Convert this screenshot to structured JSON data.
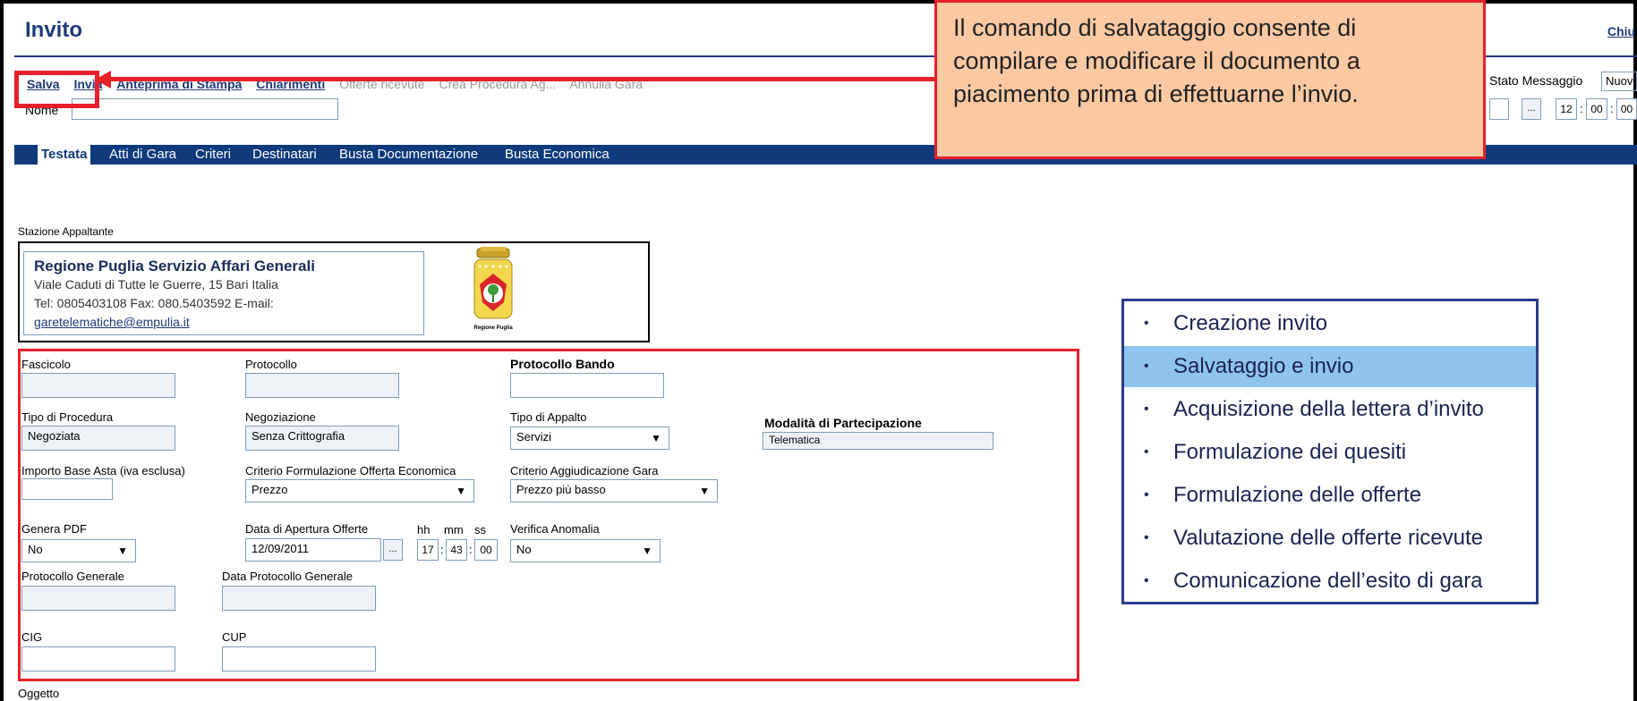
{
  "window": {
    "title": "Invito",
    "close_label": "Chiu"
  },
  "toolbar": {
    "salva": "Salva",
    "invia": "Invia",
    "anteprima": "Anteprima di Stampa",
    "chiarimenti": "Chiarimenti",
    "offerte": "Offerte ricevute",
    "crea_procedura": "Crea Procedura Ag...",
    "annulla": "Annulla Gara"
  },
  "header": {
    "name_label": "Nome",
    "name_value": "",
    "stato_label": "Stato Messaggio",
    "stato_value": "Nuov",
    "date_btn": "...",
    "time": {
      "hh": "12",
      "mm": "00",
      "ss": "00",
      "sep": ":"
    }
  },
  "tabs": [
    "Testata",
    "Atti di Gara",
    "Criteri",
    "Destinatari",
    "Busta Documentazione",
    "Busta Economica"
  ],
  "stazione": {
    "section_label": "Stazione Appaltante",
    "name": "Regione Puglia Servizio Affari Generali",
    "address": "Viale Caduti di Tutte le Guerre, 15 Bari Italia",
    "contacts": "Tel: 0805403108 Fax: 080.5403592 E-mail:",
    "email": "garetelematiche@empulia.it",
    "logo_caption": "Regione Puglia"
  },
  "form": {
    "fascicolo": {
      "label": "Fascicolo",
      "value": ""
    },
    "protocollo": {
      "label": "Protocollo",
      "value": ""
    },
    "protocollo_bando": {
      "label": "Protocollo Bando",
      "value": ""
    },
    "tipo_procedura": {
      "label": "Tipo di Procedura",
      "value": "Negoziata"
    },
    "negoziazione": {
      "label": "Negoziazione",
      "value": "Senza Crittografia"
    },
    "tipo_appalto": {
      "label": "Tipo di Appalto",
      "value": "Servizi"
    },
    "modalita": {
      "label": "Modalità di Partecipazione",
      "value": "Telematica"
    },
    "importo": {
      "label": "Importo Base Asta (iva esclusa)",
      "value": ""
    },
    "criterio_formulazione": {
      "label": "Criterio Formulazione Offerta Economica",
      "value": "Prezzo"
    },
    "criterio_aggiudicazione": {
      "label": "Criterio Aggiudicazione Gara",
      "value": "Prezzo più basso"
    },
    "genera_pdf": {
      "label": "Genera PDF",
      "value": "No"
    },
    "data_apertura": {
      "label": "Data di Apertura Offerte",
      "value": "12/09/2011",
      "btn": "..."
    },
    "ora_labels": {
      "hh": "hh",
      "mm": "mm",
      "ss": "ss"
    },
    "ora_values": {
      "hh": "17",
      "mm": "43",
      "ss": "00"
    },
    "verifica": {
      "label": "Verifica Anomalia",
      "value": "No"
    },
    "protocollo_generale": {
      "label": "Protocollo Generale",
      "value": ""
    },
    "data_protocollo": {
      "label": "Data Protocollo Generale",
      "value": ""
    },
    "cig": {
      "label": "CIG",
      "value": ""
    },
    "cup": {
      "label": "CUP",
      "value": ""
    },
    "oggetto": {
      "label": "Oggetto"
    }
  },
  "callout": {
    "text": "Il comando di salvataggio consente di compilare e modificare il documento a piacimento prima di effettuarne l’invio."
  },
  "steps": {
    "items": [
      "Creazione invito",
      "Salvataggio e invio",
      "Acquisizione della lettera d’invito",
      "Formulazione dei quesiti",
      "Formulazione delle offerte",
      "Valutazione delle offerte ricevute",
      "Comunicazione dell’esito di gara"
    ],
    "active_index": 1,
    "bullet": "•"
  },
  "colors": {
    "brand_blue": "#1f3a7a",
    "tab_bar": "#0e3a7c",
    "highlight_red": "#e8202a",
    "callout_bg": "#fcc9a3",
    "step_active": "#8fc4ee"
  }
}
